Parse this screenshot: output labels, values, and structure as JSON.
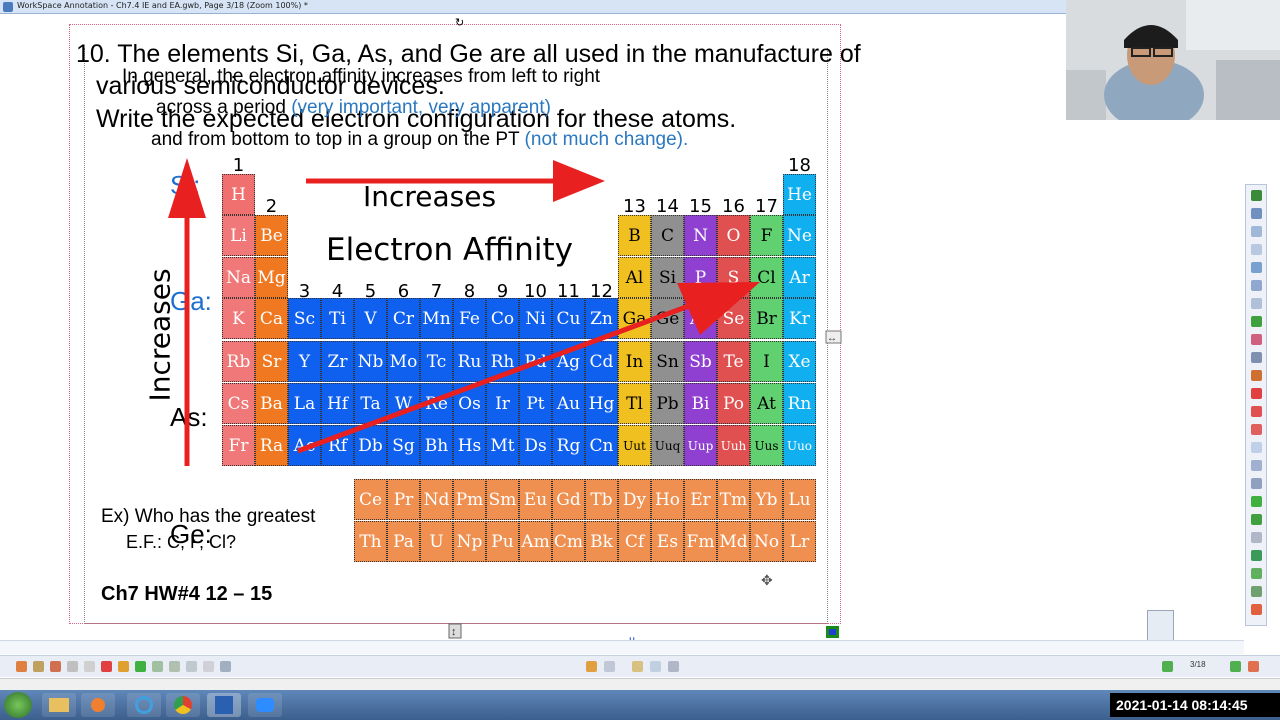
{
  "window": {
    "title": "WorkSpace Annotation - Ch7.4 IE and EA.gwb, Page 3/18 (Zoom 100%) *"
  },
  "question": {
    "line1": "10. The elements Si, Ga, As, and Ge are all used in the manufacture of",
    "line2": "various semiconductor devices.",
    "line3": "Write the expected electron configuration for these atoms."
  },
  "ea_text": {
    "line1": "In general, the electron affinity increases from left to right",
    "line2_black": "across a period",
    "line2_blue": "(very important, very apparent)",
    "line3_black": "and from bottom to top in a group on the PT",
    "line3_blue": "(not much change)."
  },
  "labels": {
    "si": "Si:",
    "ga": "Ga:",
    "as": "As:",
    "ge": "Ge:"
  },
  "chart_labels": {
    "increases_horizontal": "Increases",
    "title": "Electron Affinity",
    "increases_vertical": "Increases"
  },
  "groups": {
    "g1": "1",
    "g2": "2",
    "g3": "3",
    "g4": "4",
    "g5": "5",
    "g6": "6",
    "g7": "7",
    "g8": "8",
    "g9": "9",
    "g10": "10",
    "g11": "11",
    "g12": "12",
    "g13": "13",
    "g14": "14",
    "g15": "15",
    "g16": "16",
    "g17": "17",
    "g18": "18"
  },
  "elements": {
    "H": "H",
    "He": "He",
    "Li": "Li",
    "Be": "Be",
    "B": "B",
    "C": "C",
    "N": "N",
    "O": "O",
    "F": "F",
    "Ne": "Ne",
    "Na": "Na",
    "Mg": "Mg",
    "Al": "Al",
    "Si": "Si",
    "P": "P",
    "S": "S",
    "Cl": "Cl",
    "Ar": "Ar",
    "K": "K",
    "Ca": "Ca",
    "Sc": "Sc",
    "Ti": "Ti",
    "V": "V",
    "Cr": "Cr",
    "Mn": "Mn",
    "Fe": "Fe",
    "Co": "Co",
    "Ni": "Ni",
    "Cu": "Cu",
    "Zn": "Zn",
    "Ga": "Ga",
    "Ge": "Ge",
    "As": "As",
    "Se": "Se",
    "Br": "Br",
    "Kr": "Kr",
    "Rb": "Rb",
    "Sr": "Sr",
    "Y": "Y",
    "Zr": "Zr",
    "Nb": "Nb",
    "Mo": "Mo",
    "Tc": "Tc",
    "Ru": "Ru",
    "Rh": "Rh",
    "Pd": "Pd",
    "Ag": "Ag",
    "Cd": "Cd",
    "In": "In",
    "Sn": "Sn",
    "Sb": "Sb",
    "Te": "Te",
    "I": "I",
    "Xe": "Xe",
    "Cs": "Cs",
    "Ba": "Ba",
    "La": "La",
    "Hf": "Hf",
    "Ta": "Ta",
    "W": "W",
    "Re": "Re",
    "Os": "Os",
    "Ir": "Ir",
    "Pt": "Pt",
    "Au": "Au",
    "Hg": "Hg",
    "Tl": "Tl",
    "Pb": "Pb",
    "Bi": "Bi",
    "Po": "Po",
    "At": "At",
    "Rn": "Rn",
    "Fr": "Fr",
    "Ra": "Ra",
    "Ac": "Ac",
    "Rf": "Rf",
    "Db": "Db",
    "Sg": "Sg",
    "Bh": "Bh",
    "Hs": "Hs",
    "Mt": "Mt",
    "Ds": "Ds",
    "Rg": "Rg",
    "Cn": "Cn",
    "Uut": "Uut",
    "Uuq": "Uuq",
    "Uup": "Uup",
    "Uuh": "Uuh",
    "Uus": "Uus",
    "Uuo": "Uuo",
    "Ce": "Ce",
    "Pr": "Pr",
    "Nd": "Nd",
    "Pm": "Pm",
    "Sm": "Sm",
    "Eu": "Eu",
    "Gd": "Gd",
    "Tb": "Tb",
    "Dy": "Dy",
    "Ho": "Ho",
    "Er": "Er",
    "Tm": "Tm",
    "Yb": "Yb",
    "Lu": "Lu",
    "Th": "Th",
    "Pa": "Pa",
    "U": "U",
    "Np": "Np",
    "Pu": "Pu",
    "Am": "Am",
    "Cm": "Cm",
    "Bk": "Bk",
    "Cf": "Cf",
    "Es": "Es",
    "Fm": "Fm",
    "Md": "Md",
    "No": "No",
    "Lr": "Lr"
  },
  "example": {
    "line1": "Ex) Who has the greatest",
    "line2": "E.F.: C, F, Cl?"
  },
  "homework": "Ch7 HW#4 12 – 15",
  "page_counter": "3/18",
  "clock": "2021-01-14  08:14:45",
  "colors": {
    "hydrogen": "#f07070",
    "alkali": "#f07878",
    "alkaline": "#f07820",
    "transition": "#1060f0",
    "boron": "#f0c020",
    "carbon": "#909090",
    "nitrogen": "#9040d0",
    "oxygen": "#e05050",
    "halogen": "#60d070",
    "noble": "#10b0f0",
    "f_block": "#f09050",
    "arrow": "#e82020"
  },
  "icons": [
    "windows-start-icon",
    "file-explorer-icon",
    "media-player-icon",
    "internet-explorer-icon",
    "chrome-icon",
    "word-icon",
    "zoom-icon"
  ]
}
